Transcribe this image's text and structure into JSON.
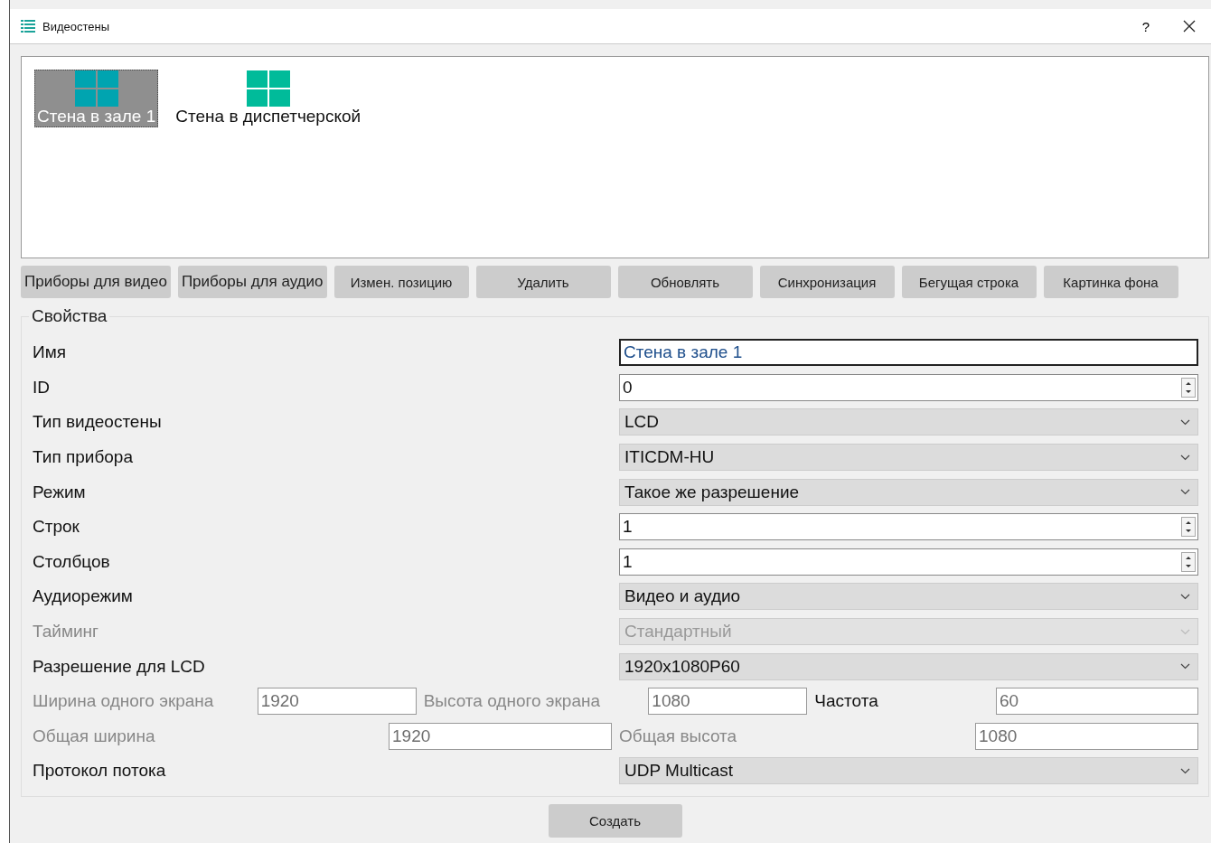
{
  "window": {
    "title": "Видеостены",
    "help": "?"
  },
  "walls": [
    {
      "label": "Стена в зале 1",
      "selected": true
    },
    {
      "label": "Стена в диспетчерской",
      "selected": false
    }
  ],
  "toolbar": [
    "Приборы для видео",
    "Приборы для аудио",
    "Измен. позицию",
    "Удалить",
    "Обновлять",
    "Синхронизация",
    "Бегущая строка",
    "Картинка фона"
  ],
  "properties": {
    "title": "Свойства",
    "rows": [
      {
        "kind": "text",
        "label": "Имя",
        "value": "Стена в зале 1",
        "focused": true,
        "disabled": false
      },
      {
        "kind": "spin",
        "label": "ID",
        "value": "0",
        "disabled": false
      },
      {
        "kind": "combo",
        "label": "Тип видеостены",
        "value": "LCD",
        "disabled": false
      },
      {
        "kind": "combo",
        "label": "Тип прибора",
        "value": "ITICDM-HU",
        "disabled": false
      },
      {
        "kind": "combo",
        "label": "Режим",
        "value": "Такое же разрешение",
        "disabled": false
      },
      {
        "kind": "spin",
        "label": "Строк",
        "value": "1",
        "disabled": false
      },
      {
        "kind": "spin",
        "label": "Столбцов",
        "value": "1",
        "disabled": false
      },
      {
        "kind": "combo",
        "label": "Аудиорежим",
        "value": "Видео и аудио",
        "disabled": false
      },
      {
        "kind": "combo",
        "label": "Тайминг",
        "value": "Стандартный",
        "disabled": true
      },
      {
        "kind": "combo",
        "label": "Разрешение для LCD",
        "value": "1920x1080P60",
        "disabled": false
      },
      {
        "kind": "fields",
        "fields": [
          {
            "label": "Ширина одного экрана",
            "label_disabled": true,
            "value": "1920",
            "disabled": true
          },
          {
            "label": "Высота одного экрана",
            "label_disabled": true,
            "value": "1080",
            "disabled": true
          },
          {
            "label": "Частота",
            "label_disabled": false,
            "value": "60",
            "disabled": true
          }
        ]
      },
      {
        "kind": "fields",
        "fields": [
          {
            "label": "Общая ширина",
            "label_disabled": true,
            "value": "1920",
            "disabled": true
          },
          {
            "label": "Общая высота",
            "label_disabled": true,
            "value": "1080",
            "disabled": true
          }
        ]
      },
      {
        "kind": "combo",
        "label": "Протокол потока",
        "value": "UDP Multicast",
        "disabled": false
      }
    ]
  },
  "create_button": "Создать"
}
